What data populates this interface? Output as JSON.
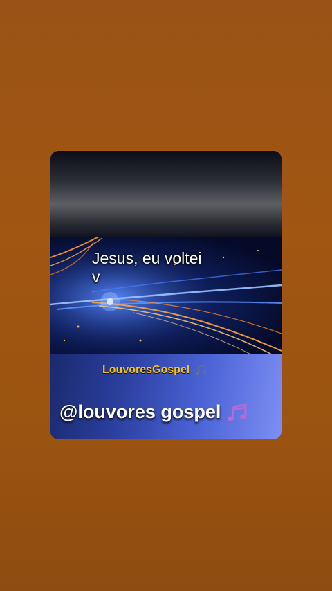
{
  "card": {
    "lyric_line1": "Jesus, eu voltei",
    "lyric_line2": "v",
    "watermark_text": "LouvoresGospel",
    "watermark_icon": "music-notes-icon",
    "handle_text": "@louvores gospel",
    "handle_icon": "music-notes-icon"
  },
  "colors": {
    "background": "#9a5316",
    "watermark": "#f3c21b",
    "handle": "#ffffff",
    "note_icon": "#b46bd8"
  }
}
